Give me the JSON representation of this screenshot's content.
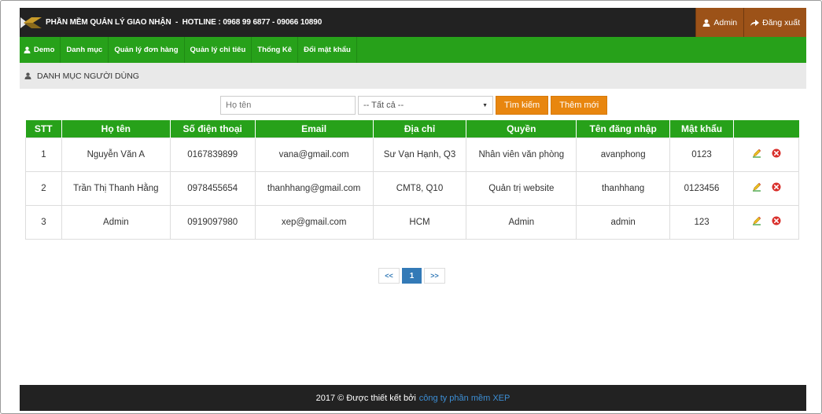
{
  "header": {
    "title": "PHẦN MỀM QUẢN LÝ GIAO NHẬN  -  HOTLINE : 0968 99 6877 - 09066 10890",
    "admin_label": "Admin",
    "logout_label": "Đăng xuất"
  },
  "nav": {
    "items": [
      {
        "label": "Demo"
      },
      {
        "label": "Danh mục"
      },
      {
        "label": "Quản lý đơn hàng"
      },
      {
        "label": "Quản lý chi tiêu"
      },
      {
        "label": "Thống Kê"
      },
      {
        "label": "Đổi mật khẩu"
      }
    ]
  },
  "breadcrumb": {
    "label": "DANH MỤC NGƯỜI DÙNG"
  },
  "search": {
    "name_placeholder": "Họ tên",
    "role_selected": "-- Tất cả --",
    "search_label": "Tìm kiếm",
    "add_label": "Thêm mới"
  },
  "table": {
    "headers": [
      "STT",
      "Họ tên",
      "Số điện thoại",
      "Email",
      "Địa chỉ",
      "Quyền",
      "Tên đăng nhập",
      "Mật khẩu"
    ],
    "rows": [
      [
        "1",
        "Nguyễn Văn A",
        "0167839899",
        "vana@gmail.com",
        "Sư Vạn Hạnh, Q3",
        "Nhân viên văn phòng",
        "avanphong",
        "0123"
      ],
      [
        "2",
        "Trần Thị Thanh Hằng",
        "0978455654",
        "thanhhang@gmail.com",
        "CMT8, Q10",
        "Quản trị website",
        "thanhhang",
        "0123456"
      ],
      [
        "3",
        "Admin",
        "0919097980",
        "xep@gmail.com",
        "HCM",
        "Admin",
        "admin",
        "123"
      ]
    ]
  },
  "pagination": {
    "prev": "<<",
    "current": "1",
    "next": ">>"
  },
  "footer": {
    "text": "2017 © Được thiết kết bởi",
    "link": "công ty phần mềm XEP"
  },
  "colors": {
    "topbar": "#222222",
    "nav_green": "#27a11a",
    "user_buttons": "#9c5218",
    "orange_buttons": "#e8860f",
    "page_link": "#337ab7"
  },
  "icons": {
    "user": "user-icon",
    "logout": "sign-out-icon",
    "edit": "pencil-icon",
    "delete": "remove-circle-icon"
  }
}
